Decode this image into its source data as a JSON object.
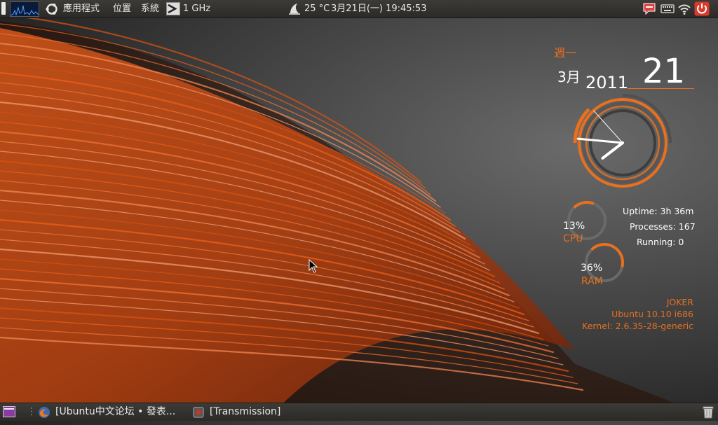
{
  "top_panel": {
    "menus": {
      "applications": "應用程式",
      "places": "位置",
      "system": "系統"
    },
    "cpu_freq": "1 GHz",
    "weather_temp": "25 °C",
    "datetime": "3月21日(一) 19:45:53"
  },
  "bottom_panel": {
    "tasks": [
      "[Ubuntu中文论坛 • 發表...",
      "[Transmission]"
    ]
  },
  "conky": {
    "weekday": "週一",
    "month": "3月",
    "year": "2011",
    "day": "21",
    "cpu": {
      "percent": "13%",
      "label": "CPU",
      "value": 0.13
    },
    "ram": {
      "percent": "36%",
      "label": "RAM",
      "value": 0.36
    },
    "uptime": "Uptime: 3h 36m",
    "processes": "Processes: 167",
    "running": "Running: 0",
    "user": "JOKER",
    "os": "Ubuntu 10.10 i686",
    "kernel": "Kernel: 2.6.35-28-generic",
    "clock": {
      "hour": 19,
      "minute": 45,
      "second": 53
    }
  },
  "colors": {
    "accent": "#e8701e",
    "panel": "#3c3b37"
  },
  "icons": [
    "ubuntu-logo-icon",
    "cpufreq-icon",
    "weather-icon",
    "chat-icon",
    "keyboard-icon",
    "wifi-icon",
    "power-icon",
    "show-desktop-icon",
    "firefox-icon",
    "transmission-icon",
    "trash-icon"
  ]
}
